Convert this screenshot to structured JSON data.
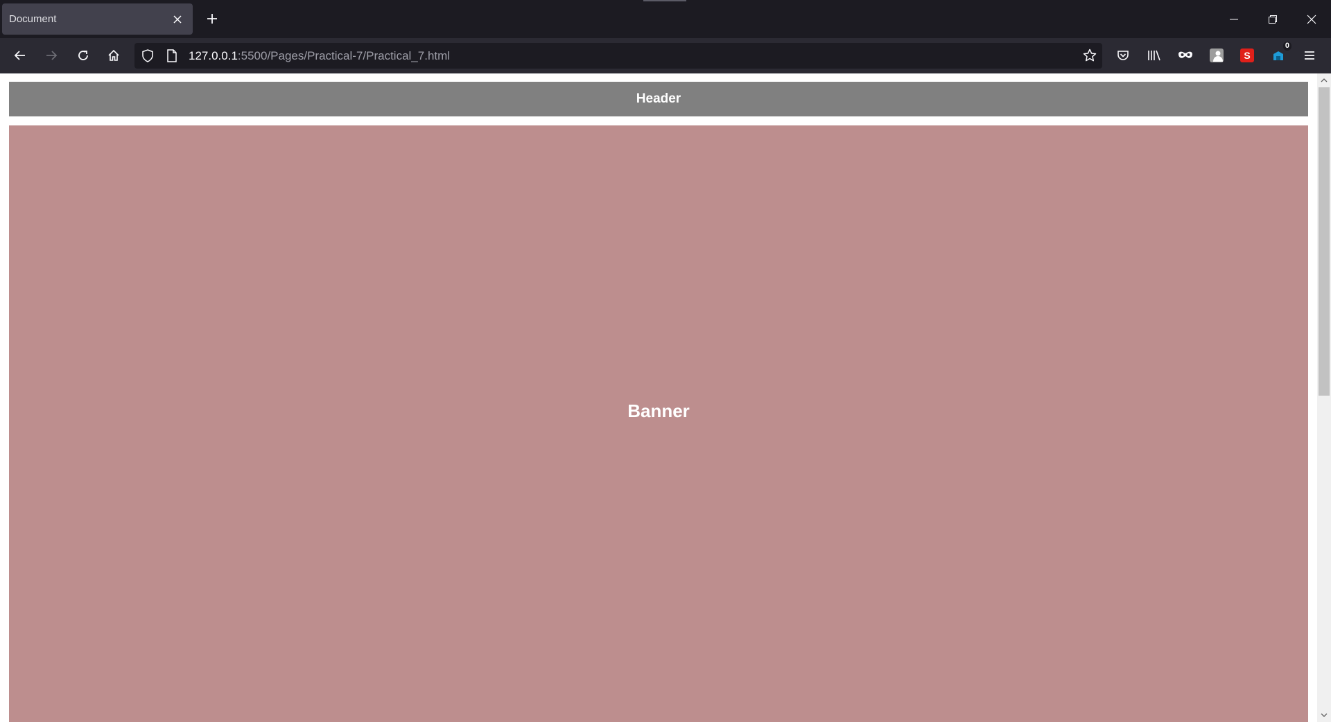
{
  "window": {
    "tab_title": "Document",
    "new_tab_icon": "plus-icon",
    "controls": [
      "minimize-icon",
      "restore-icon",
      "close-icon"
    ]
  },
  "navbar": {
    "url_host": "127.0.0.1",
    "url_rest": ":5500/Pages/Practical-7/Practical_7.html",
    "extension_badge": "0",
    "icons": [
      "back-arrow-icon",
      "forward-arrow-icon",
      "reload-icon",
      "home-icon",
      "shield-icon",
      "page-icon",
      "star-icon",
      "pocket-icon",
      "library-icon",
      "mask-icon",
      "extension-avatar-icon",
      "s-extension-icon",
      "counter-extension-icon",
      "hamburger-menu-icon"
    ]
  },
  "page": {
    "header_text": "Header",
    "banner_text": "Banner"
  },
  "colors": {
    "tabstrip_bg": "#1c1b22",
    "navbar_bg": "#2b2a33",
    "header_bg": "#808080",
    "banner_bg": "#bd8e8e",
    "s_extension": "#e0201a",
    "counter_extension": "#1e9bd7"
  }
}
